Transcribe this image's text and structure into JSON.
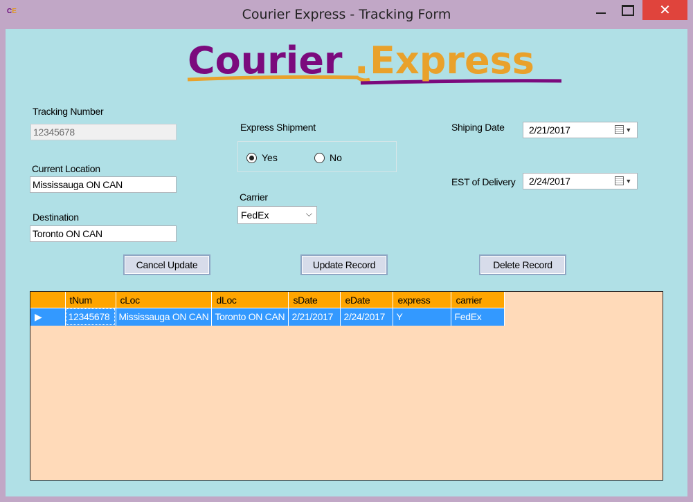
{
  "window": {
    "title": "Courier Express - Tracking Form",
    "close_glyph": "✕",
    "icon_text_c": "C",
    "icon_text_e": "E"
  },
  "logo": {
    "part1": "Courier",
    "dot": ".",
    "part2": "Express"
  },
  "form": {
    "tracking_label": "Tracking Number",
    "tracking_value": "12345678",
    "current_location_label": "Current Location",
    "current_location_value": "Mississauga ON CAN",
    "destination_label": "Destination",
    "destination_value": "Toronto ON CAN",
    "express_label": "Express Shipment",
    "express_options": {
      "yes": "Yes",
      "no": "No"
    },
    "express_selected": "Yes",
    "carrier_label": "Carrier",
    "carrier_value": "FedEx",
    "shipping_date_label": "Shiping Date",
    "shipping_date_value": "2/21/2017",
    "delivery_label": "EST of Delivery",
    "delivery_value": "2/24/2017"
  },
  "buttons": {
    "cancel": "Cancel Update",
    "update": "Update Record",
    "delete": "Delete Record"
  },
  "grid": {
    "columns": [
      "tNum",
      "cLoc",
      "dLoc",
      "sDate",
      "eDate",
      "express",
      "carrier"
    ],
    "rows": [
      [
        "12345678",
        "Mississauga ON CAN",
        "Toronto ON CAN",
        "2/21/2017",
        "2/24/2017",
        "Y",
        "FedEx"
      ]
    ],
    "row_indicator": "▶"
  },
  "colors": {
    "background": "#b0e0e6",
    "grid_background": "#ffdab9",
    "header": "#ffa500",
    "selection": "#3399ff",
    "logo_purple": "#7b0a7d",
    "logo_orange": "#e9a12b"
  },
  "icons": [
    "app-icon",
    "minimize-icon",
    "maximize-icon",
    "close-icon",
    "calendar-icon",
    "dropdown-arrow-icon",
    "row-selector-icon"
  ]
}
